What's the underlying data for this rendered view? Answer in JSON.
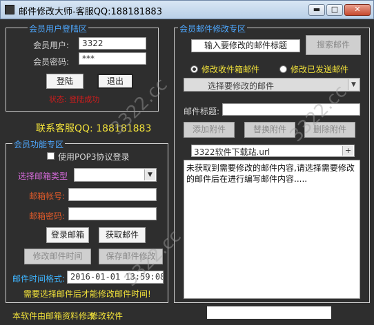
{
  "window": {
    "title": "邮件修改大师-客服QQ:188181883",
    "min": "▬",
    "max": "□",
    "close": "✕"
  },
  "login": {
    "group_title": "会员用户登陆区",
    "user_label": "会员用户:",
    "user_value": "3322",
    "pass_label": "会员密码:",
    "pass_value": "***",
    "login_button": "登陆",
    "exit_button": "退出",
    "status": "状态: 登陆成功"
  },
  "contact": "联系客服QQ: 188181883",
  "functions": {
    "group_title": "会员功能专区",
    "pop3_label": "使用POP3协议登录",
    "mailbox_type_label": "选择邮箱类型",
    "mailbox_type_value": "",
    "account_label": "邮箱帐号:",
    "account_value": "",
    "password_label": "邮箱密码:",
    "password_value": "",
    "login_mailbox_button": "登录邮箱",
    "fetch_mail_button": "获取邮件",
    "modify_time_button": "修改邮件时间",
    "save_modify_button": "保存邮件修改",
    "time_format_label": "邮件时间格式:",
    "time_value": "2016-01-01 13:59:08",
    "notice": "需要选择邮件后才能修改邮件时间!"
  },
  "editor": {
    "group_title": "会员邮件修改专区",
    "search_input_value": "输入要修改的邮件标题",
    "search_button": "搜索邮件",
    "radio_inbox": "修改收件箱邮件",
    "radio_sent": "修改已发送邮件",
    "select_mail_value": "选择要修改的邮件",
    "subject_label": "邮件标题:",
    "subject_value": "",
    "add_attachment": "添加附件",
    "replace_attachment": "替换附件",
    "delete_attachment": "删除附件",
    "attachment_value": "3322软件下载站.url",
    "attachment_arrow": "+",
    "body_text": "未获取到需要修改的邮件内容,请选择需要修改的邮件后在进行编写邮件内容....."
  },
  "footer": {
    "text": "本软件由邮箱资料修改",
    "text2": "修改软件"
  },
  "watermark": "3322.cc"
}
